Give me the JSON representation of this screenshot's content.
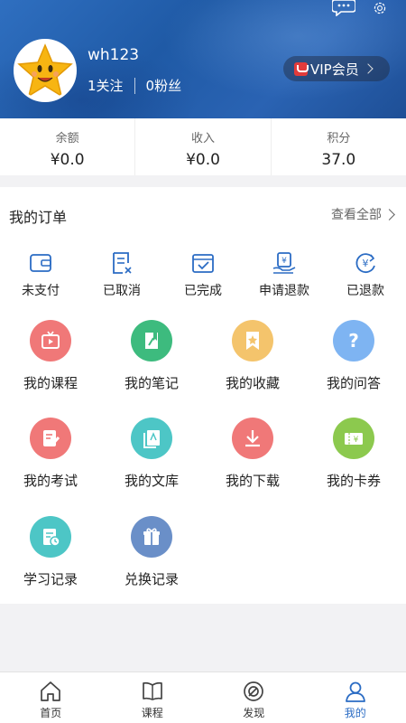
{
  "profile": {
    "username": "wh123",
    "following": "1关注",
    "followers": "0粉丝",
    "vip_label": "VIP会员"
  },
  "stats": [
    {
      "label": "余额",
      "value": "¥0.0"
    },
    {
      "label": "收入",
      "value": "¥0.0"
    },
    {
      "label": "积分",
      "value": "37.0"
    }
  ],
  "orders": {
    "title": "我的订单",
    "view_all": "查看全部",
    "items": [
      {
        "label": "未支付",
        "icon": "wallet-icon"
      },
      {
        "label": "已取消",
        "icon": "cancelled-doc-icon"
      },
      {
        "label": "已完成",
        "icon": "completed-icon"
      },
      {
        "label": "申请退款",
        "icon": "refund-request-icon"
      },
      {
        "label": "已退款",
        "icon": "refunded-icon"
      }
    ]
  },
  "features": [
    {
      "label": "我的课程",
      "icon": "play-icon",
      "color": "#f07878"
    },
    {
      "label": "我的笔记",
      "icon": "note-icon",
      "color": "#3dbb7e"
    },
    {
      "label": "我的收藏",
      "icon": "bookmark-icon",
      "color": "#f4c46c"
    },
    {
      "label": "我的问答",
      "icon": "question-icon",
      "color": "#7eb4f2"
    },
    {
      "label": "我的考试",
      "icon": "exam-icon",
      "color": "#f07878"
    },
    {
      "label": "我的文库",
      "icon": "library-icon",
      "color": "#4dc6c6"
    },
    {
      "label": "我的下载",
      "icon": "download-icon",
      "color": "#f07878"
    },
    {
      "label": "我的卡券",
      "icon": "coupon-icon",
      "color": "#8cc94e"
    },
    {
      "label": "学习记录",
      "icon": "study-record-icon",
      "color": "#4dc6c6"
    },
    {
      "label": "兑换记录",
      "icon": "gift-icon",
      "color": "#6a8fc8"
    }
  ],
  "nav": [
    {
      "label": "首页",
      "icon": "home-icon"
    },
    {
      "label": "课程",
      "icon": "book-icon"
    },
    {
      "label": "发现",
      "icon": "discover-icon"
    },
    {
      "label": "我的",
      "icon": "user-icon",
      "active": true
    }
  ],
  "colors": {
    "accent": "#2b6cc4",
    "header": "#2a63b3"
  }
}
